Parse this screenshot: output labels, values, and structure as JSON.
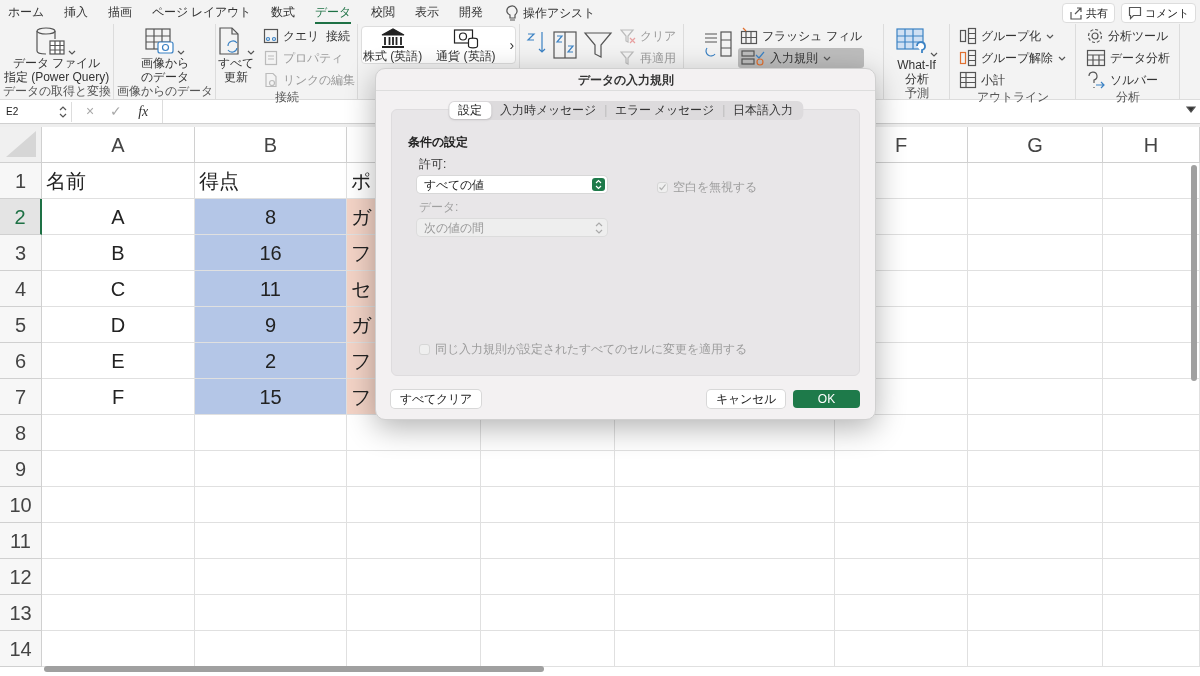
{
  "ribbon_tabs": [
    {
      "label": "ホーム",
      "selected": false
    },
    {
      "label": "挿入",
      "selected": false
    },
    {
      "label": "描画",
      "selected": false
    },
    {
      "label": "ページ レイアウト",
      "selected": false
    },
    {
      "label": "数式",
      "selected": false
    },
    {
      "label": "データ",
      "selected": true
    },
    {
      "label": "校閲",
      "selected": false
    },
    {
      "label": "表示",
      "selected": false
    },
    {
      "label": "開発",
      "selected": false
    }
  ],
  "assist": "操作アシスト",
  "header_buttons": [
    {
      "kind": "share",
      "label": "共有"
    },
    {
      "kind": "comment",
      "label": "コメント"
    }
  ],
  "ribbon_groups": [
    {
      "label": "データの取得と変換",
      "items": [
        {
          "kind": "large",
          "lines": [
            "データ ファイル",
            "指定 (Power Query)"
          ],
          "dropdown": true
        }
      ]
    },
    {
      "label": "画像からのデータ",
      "items": [
        {
          "kind": "large",
          "lines": [
            "画像から",
            "のデータ"
          ],
          "dropdown": true
        }
      ]
    },
    {
      "label": "接続",
      "items": [
        {
          "kind": "large",
          "lines": [
            "すべて",
            "更新"
          ],
          "dropdown": true
        },
        {
          "kind": "small",
          "label": "クエリ  接続",
          "disabled": false
        },
        {
          "kind": "small",
          "label": "プロパティ",
          "disabled": true
        },
        {
          "kind": "small",
          "label": "リンクの編集",
          "disabled": true
        }
      ]
    },
    {
      "kind": "types",
      "items": [
        {
          "kind": "type",
          "label": "株式 (英語)"
        },
        {
          "kind": "type",
          "label": "通貨 (英語)"
        },
        {
          "kind": "more",
          "label": "›"
        }
      ]
    },
    {
      "items": [
        {
          "kind": "tool"
        },
        {
          "kind": "tool"
        },
        {
          "kind": "tool"
        },
        {
          "kind": "small",
          "label": "クリア",
          "disabled": true
        },
        {
          "kind": "small",
          "label": "再適用",
          "disabled": true
        }
      ]
    },
    {
      "items": [
        {
          "kind": "tool"
        },
        {
          "kind": "small",
          "label": "フラッシュ フィル",
          "disabled": false
        },
        {
          "kind": "small",
          "label": "入力規則",
          "disabled": false,
          "active": true,
          "dropdown": true
        }
      ]
    },
    {
      "label": "予測",
      "items": [
        {
          "kind": "large",
          "lines": [
            "What-If",
            "分析"
          ],
          "dropdown": true
        }
      ]
    },
    {
      "label": "アウトライン",
      "items": [
        {
          "kind": "small",
          "label": "グループ化",
          "disabled": false,
          "dropdown": true
        },
        {
          "kind": "small",
          "label": "グループ解除",
          "disabled": false,
          "dropdown": true
        },
        {
          "kind": "small",
          "label": "小計",
          "disabled": false
        }
      ]
    },
    {
      "label": "分析",
      "items": [
        {
          "kind": "small",
          "label": "分析ツール",
          "disabled": false
        },
        {
          "kind": "small",
          "label": "データ分析",
          "disabled": false
        },
        {
          "kind": "small",
          "label": "ソルバー",
          "disabled": false
        }
      ]
    }
  ],
  "name_box": "E2",
  "formula_icons": [
    "×",
    "✓",
    "fx"
  ],
  "columns": [
    {
      "label": "A"
    },
    {
      "label": "B"
    },
    {
      "label": "F"
    },
    {
      "label": "G"
    },
    {
      "label": "H"
    }
  ],
  "rows": [
    {
      "header": "1",
      "selected": false,
      "kind": "heading",
      "cells": [
        {
          "text": "名前"
        },
        {
          "text": "得点"
        },
        {
          "text": "ポ"
        }
      ]
    },
    {
      "header": "2",
      "selected": true,
      "kind": "data",
      "cells": [
        {
          "text": "A"
        },
        {
          "text": "8",
          "color": "#b4c6e7"
        },
        {
          "text": "ガ",
          "color": "#f3d3c6"
        }
      ]
    },
    {
      "header": "3",
      "selected": false,
      "kind": "data",
      "cells": [
        {
          "text": "B"
        },
        {
          "text": "16",
          "color": "#b4c6e7"
        },
        {
          "text": "フ",
          "color": "#f3d3c6"
        }
      ]
    },
    {
      "header": "4",
      "selected": false,
      "kind": "data",
      "cells": [
        {
          "text": "C"
        },
        {
          "text": "11",
          "color": "#b4c6e7"
        },
        {
          "text": "セ",
          "color": "#f3d3c6"
        }
      ]
    },
    {
      "header": "5",
      "selected": false,
      "kind": "data",
      "cells": [
        {
          "text": "D"
        },
        {
          "text": "9",
          "color": "#b4c6e7"
        },
        {
          "text": "ガ",
          "color": "#f3d3c6"
        }
      ]
    },
    {
      "header": "6",
      "selected": false,
      "kind": "data",
      "cells": [
        {
          "text": "E"
        },
        {
          "text": "2",
          "color": "#b4c6e7"
        },
        {
          "text": "フ",
          "color": "#f3d3c6"
        }
      ]
    },
    {
      "header": "7",
      "selected": false,
      "kind": "data",
      "cells": [
        {
          "text": "F"
        },
        {
          "text": "15",
          "color": "#b4c6e7"
        },
        {
          "text": "フ",
          "color": "#f3d3c6"
        }
      ]
    },
    {
      "header": "8",
      "selected": false,
      "kind": "data",
      "cells": []
    },
    {
      "header": "9",
      "selected": false,
      "kind": "data",
      "cells": []
    },
    {
      "header": "10",
      "selected": false,
      "kind": "data",
      "cells": []
    },
    {
      "header": "11",
      "selected": false,
      "kind": "data",
      "cells": []
    },
    {
      "header": "12",
      "selected": false,
      "kind": "data",
      "cells": []
    },
    {
      "header": "13",
      "selected": false,
      "kind": "data",
      "cells": []
    },
    {
      "header": "14",
      "selected": false,
      "kind": "data",
      "cells": []
    }
  ],
  "dialog": {
    "title": "データの入力規則",
    "tabs": [
      {
        "label": "設定",
        "selected": true
      },
      {
        "label": "入力時メッセージ",
        "selected": false
      },
      {
        "label": "エラー メッセージ",
        "selected": false
      },
      {
        "label": "日本語入力",
        "selected": false
      }
    ],
    "section": "条件の設定",
    "allow_label": "許可:",
    "allow_value": "すべての値",
    "data_label": "データ:",
    "data_value": "次の値の間",
    "data_disabled": true,
    "ignore_blank": {
      "label": "空白を無視する",
      "checked": true,
      "disabled": true
    },
    "apply_all": {
      "label": "同じ入力規則が設定されたすべてのセルに変更を適用する",
      "checked": false,
      "disabled": true
    },
    "buttons": [
      {
        "kind": "secondary",
        "label": "すべてクリア"
      },
      {
        "kind": "secondary",
        "label": "キャンセル"
      },
      {
        "kind": "primary",
        "label": "OK"
      }
    ]
  }
}
